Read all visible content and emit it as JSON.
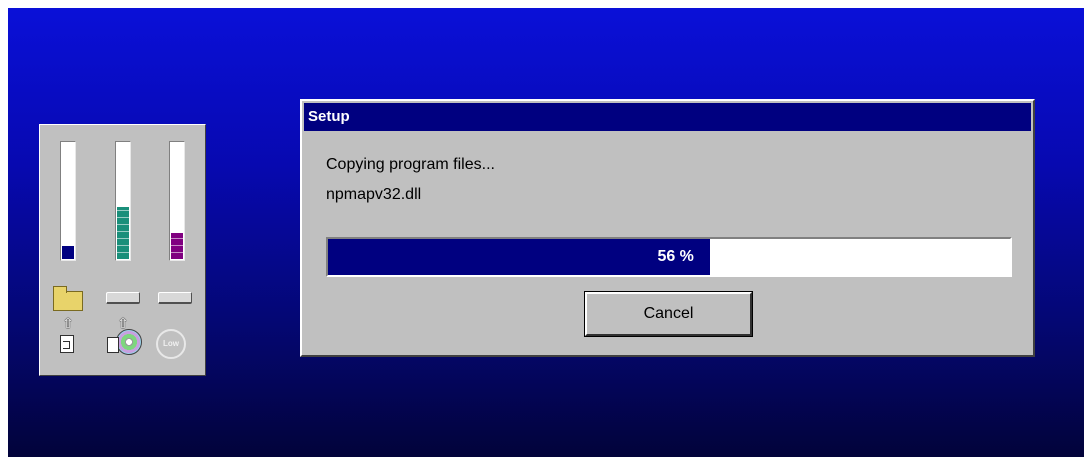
{
  "meters": [
    {
      "name": "meter-disk",
      "fill": 0.11,
      "color": "#000080"
    },
    {
      "name": "meter-memory",
      "fill": 0.45,
      "color": "#1a8f7a"
    },
    {
      "name": "meter-cpu",
      "fill": 0.22,
      "color": "#800080"
    }
  ],
  "icons": {
    "folder": "folder-icon",
    "drive1": "drive-icon",
    "drive2": "drive-icon",
    "arrow": "up-arrow-icon",
    "doc": "document-icon",
    "cd": "cd-icon",
    "floppy": "floppy-icon",
    "stop": "stop-icon",
    "stop_label": "Low"
  },
  "dialog": {
    "title": "Setup",
    "status": "Copying program files...",
    "filename": "npmapv32.dll",
    "progress": 56,
    "progress_label": "56 %",
    "cancel_label": "Cancel"
  },
  "colors": {
    "titlebar": "#000080",
    "progress_fill": "#000080",
    "panel": "#c0c0c0"
  }
}
